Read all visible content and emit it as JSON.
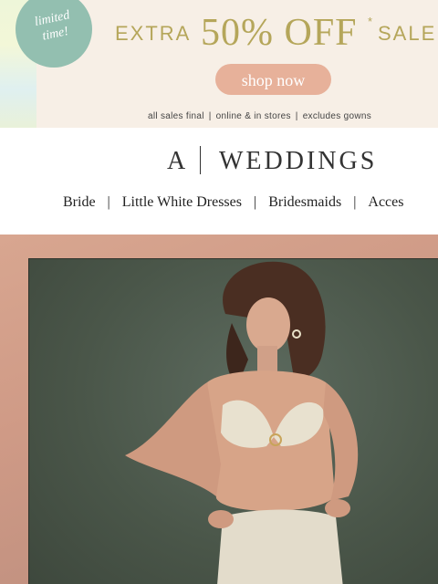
{
  "promo": {
    "badge": {
      "line1": "limited",
      "line2": "time!"
    },
    "headline": {
      "left": "EXTRA",
      "big": "50% OFF",
      "star": "*",
      "right": "SALE"
    },
    "cta_label": "shop now",
    "disclaimer": [
      "all sales final",
      "online & in stores",
      "excludes gowns"
    ],
    "disclaimer_sep": "|"
  },
  "brand": {
    "mark": "A",
    "name": "WEDDINGS"
  },
  "nav": {
    "items": [
      "Bride",
      "Little White Dresses",
      "Bridesmaids",
      "Acces"
    ],
    "separator": "|"
  },
  "colors": {
    "promo_bg": "#f7efe6",
    "badge": "#93bfb0",
    "headline_gold": "#b5a65a",
    "cta": "#e7b19a",
    "hero_frame": "#d8a690",
    "hero_backdrop": "#4a5649"
  }
}
